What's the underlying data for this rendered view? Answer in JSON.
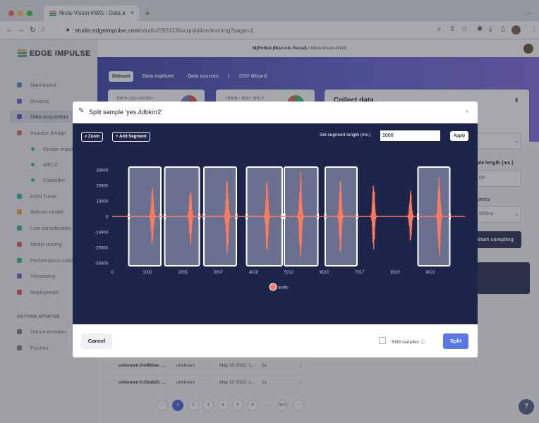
{
  "browser": {
    "tab_title": "Nicla-Vision-KWS - Data a",
    "url_host": "studio.edgeimpulse.com",
    "url_path": "/studio/292418/acquisition/training?page=1"
  },
  "app": {
    "logo": "EDGE IMPULSE",
    "breadcrumb_user": "MjRoBot (Marcelo Rovai)",
    "breadcrumb_sep": "/",
    "breadcrumb_project": "Nicla-Vision-KWS"
  },
  "sidebar": {
    "items": [
      {
        "label": "Dashboard",
        "color": "#4f7fd9"
      },
      {
        "label": "Devices",
        "color": "#6b5bd6"
      },
      {
        "label": "Data acquisition",
        "color": "#5d49c8"
      },
      {
        "label": "Impulse design",
        "color": "#e0634d"
      },
      {
        "label": "Create impulse",
        "color": "#25c26e"
      },
      {
        "label": "MFCC",
        "color": "#25c26e"
      },
      {
        "label": "Classifier",
        "color": "#25c26e"
      },
      {
        "label": "EON Tuner",
        "color": "#25b0a0"
      },
      {
        "label": "Retrain model",
        "color": "#f29b33"
      },
      {
        "label": "Live classification",
        "color": "#3aaa9a"
      },
      {
        "label": "Model testing",
        "color": "#e05062"
      },
      {
        "label": "Performance calibration",
        "color": "#25c26e"
      },
      {
        "label": "Versioning",
        "color": "#6b5bd6"
      },
      {
        "label": "Deployment",
        "color": "#e04848"
      }
    ],
    "getting_started": "GETTING STARTED",
    "footer_items": [
      {
        "label": "Documentation"
      },
      {
        "label": "Forums"
      }
    ]
  },
  "tabs": [
    "Dataset",
    "Data explorer",
    "Data sources",
    "|",
    "CSV Wizard"
  ],
  "cards": {
    "data_collected": "DATA COLLECTED",
    "train_test_split": "TRAIN / TEST SPLIT",
    "collect_data": "Collect data"
  },
  "right_panel": {
    "sample_length": "ple length (ms.)",
    "sample_length_value": "00",
    "frequency_label": "uency",
    "frequency_value": "000Hz",
    "start_sampling": "Start sampling"
  },
  "table": {
    "rows": [
      {
        "name": "unknown.fce96bac_...",
        "label": "unknown",
        "added": "May 22 2023, 1...",
        "length": "1s"
      },
      {
        "name": "unknown.fc3ba625_...",
        "label": "unknown",
        "added": "May 22 2023, 1...",
        "length": "1s"
      }
    ]
  },
  "pagination": [
    "‹",
    "1",
    "2",
    "3",
    "4",
    "5",
    "6",
    "...",
    "403",
    "›"
  ],
  "modal": {
    "title": "Split sample 'yes.4dbkirr2'",
    "zoom_label": "Zoom",
    "add_segment_label": "+ Add Segment",
    "segment_length_label": "Set segment length (ms.)",
    "segment_length_value": "1000",
    "apply_label": "Apply",
    "cancel_label": "Cancel",
    "shift_samples_label": "Shift samples",
    "split_label": "Split"
  },
  "chart_data": {
    "type": "line",
    "series": [
      {
        "name": "audio",
        "color": "#ff7a5c"
      }
    ],
    "x_ticks": [
      "0",
      "1002",
      "2005",
      "3007",
      "4010",
      "5012",
      "6015",
      "7017",
      "8020",
      "9022"
    ],
    "x_tick_values": [
      0,
      1002,
      2005,
      3007,
      4010,
      5012,
      6015,
      7017,
      8020,
      9022
    ],
    "y_ticks": [
      "30000",
      "20000",
      "10000",
      "0",
      "-10000",
      "-20000",
      "-30000"
    ],
    "y_tick_values": [
      30000,
      20000,
      10000,
      0,
      -10000,
      -20000,
      -30000
    ],
    "xlim": [
      0,
      10000
    ],
    "ylim": [
      -30000,
      30000
    ],
    "bursts": [
      {
        "x": 1150,
        "amp": 21000
      },
      {
        "x": 2230,
        "amp": 19000
      },
      {
        "x": 3270,
        "amp": 28000
      },
      {
        "x": 4400,
        "amp": 26000
      },
      {
        "x": 5350,
        "amp": 29000
      },
      {
        "x": 6480,
        "amp": 24000
      },
      {
        "x": 7420,
        "amp": 22000
      },
      {
        "x": 8470,
        "amp": 17000
      },
      {
        "x": 9280,
        "amp": 30000
      }
    ],
    "segments": [
      {
        "start": 470,
        "end": 1380
      },
      {
        "start": 1490,
        "end": 2470
      },
      {
        "start": 2600,
        "end": 3520
      },
      {
        "start": 3810,
        "end": 4820
      },
      {
        "start": 4880,
        "end": 5830
      },
      {
        "start": 6040,
        "end": 6940
      },
      {
        "start": 8670,
        "end": 9570
      }
    ]
  }
}
